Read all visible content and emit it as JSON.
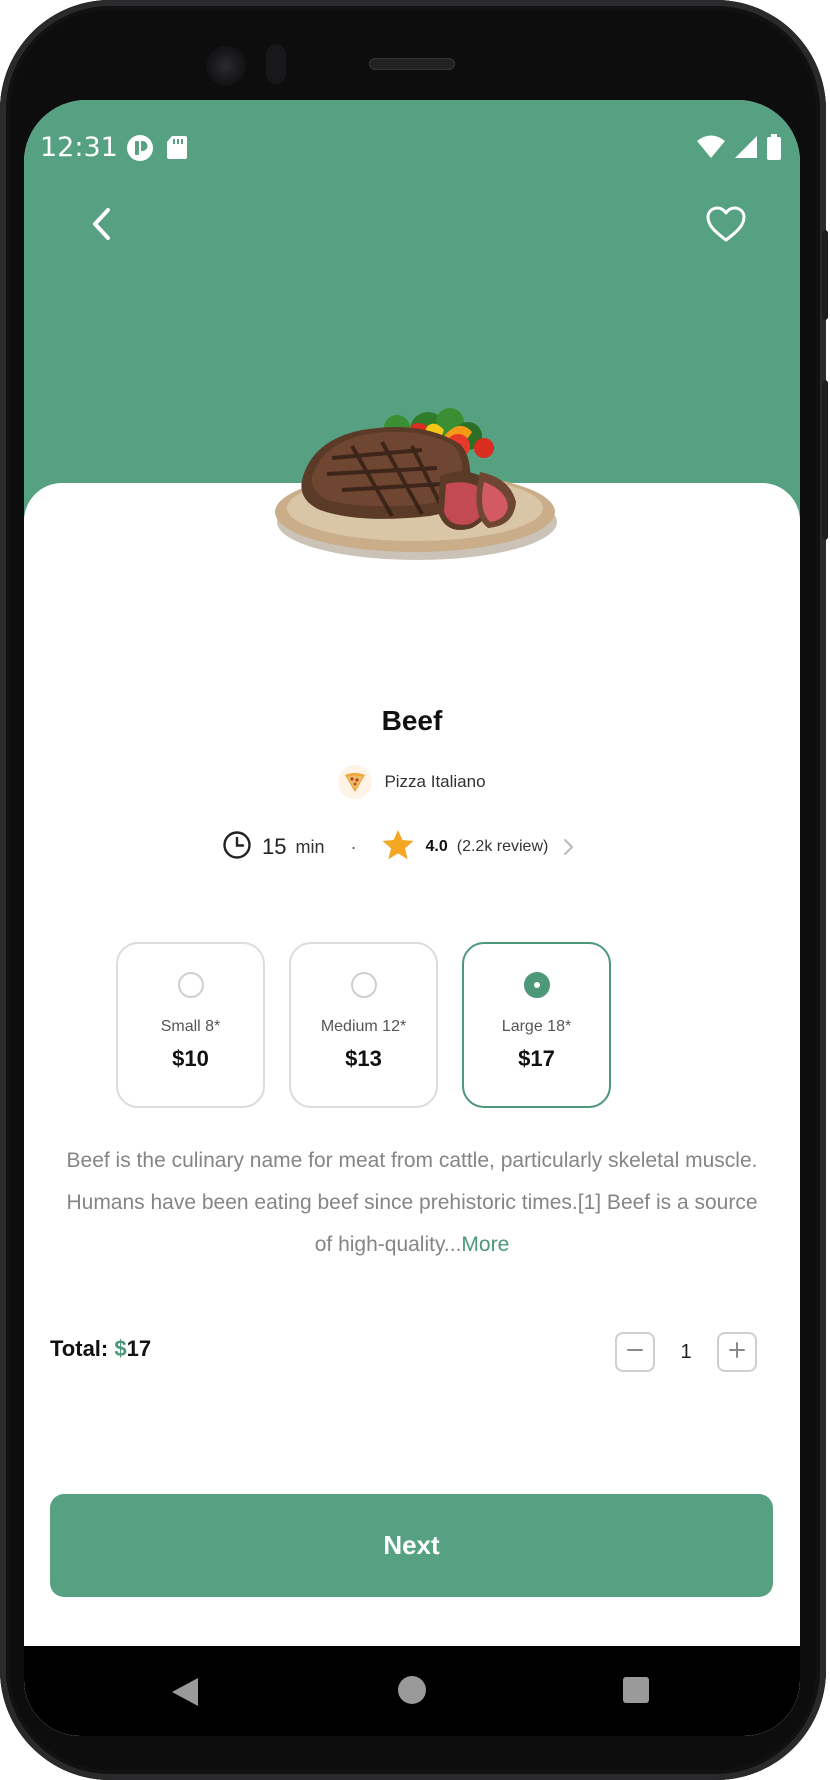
{
  "status_bar": {
    "time": "12:31",
    "left_icons": [
      "app-notification-icon",
      "sd-card-icon"
    ],
    "right_icons": [
      "wifi-icon",
      "signal-icon",
      "battery-icon"
    ]
  },
  "header": {
    "color": "#55a182",
    "back_icon": "chevron-left-icon",
    "favorite_icon": "heart-outline-icon"
  },
  "product": {
    "name": "Beef",
    "image": "steak-plate-image",
    "restaurant": {
      "logo": "pizza-slice-logo",
      "name": "Pizza Italiano"
    },
    "meta": {
      "time_value": "15",
      "time_unit": "min",
      "separator": "·",
      "rating": "4.0",
      "reviews": "(2.2k review)"
    }
  },
  "sizes": [
    {
      "name": "Small 8*",
      "price": "$10",
      "selected": false
    },
    {
      "name": "Medium 12*",
      "price": "$13",
      "selected": false
    },
    {
      "name": "Large 18*",
      "price": "$17",
      "selected": true
    }
  ],
  "description": {
    "text": "Beef is the culinary name for meat from cattle, particularly skeletal muscle. Humans have been eating beef since prehistoric times.[1] Beef is a source of high-quality...",
    "more_label": "More"
  },
  "total": {
    "label": "Total:",
    "currency": "$",
    "amount": "17"
  },
  "quantity": {
    "value": "1",
    "minus_icon": "minus-icon",
    "plus_icon": "plus-icon"
  },
  "next_button": {
    "label": "Next"
  },
  "colors": {
    "accent": "#55a182",
    "accent_dark": "#4c9878",
    "star": "#f5a623",
    "text_muted": "#858585"
  },
  "navbar": {
    "icons": [
      "nav-back-icon",
      "nav-home-icon",
      "nav-recents-icon"
    ]
  }
}
